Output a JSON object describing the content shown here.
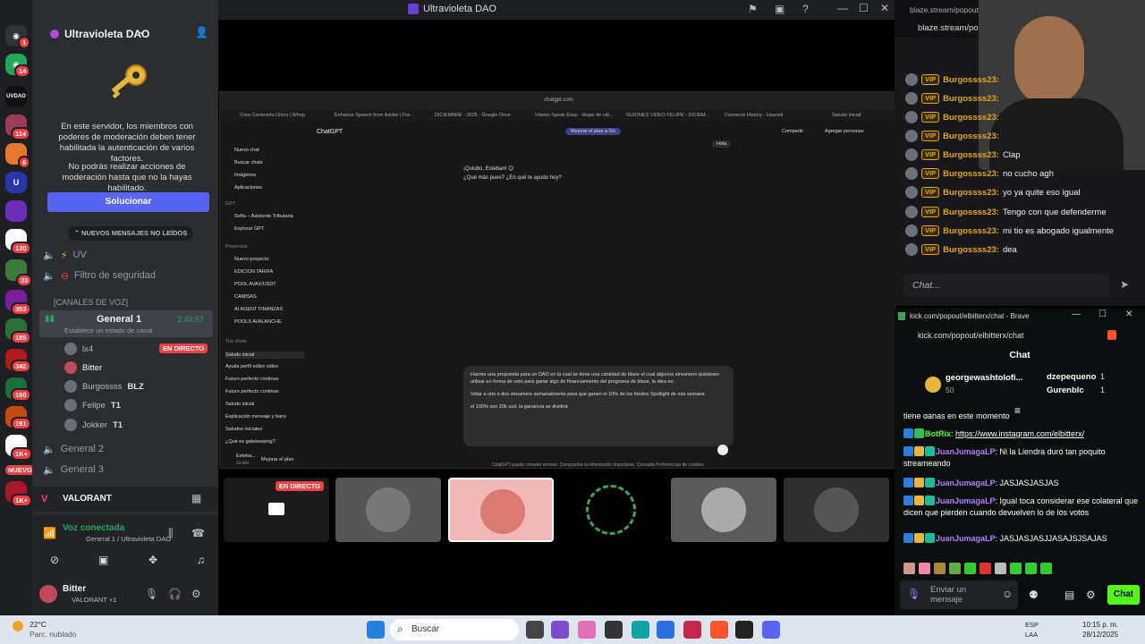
{
  "window": {
    "title": "Ultravioleta DAO"
  },
  "rail": {
    "badges": [
      "1",
      "14",
      "114",
      "6",
      "130",
      "33",
      "353",
      "185",
      "342",
      "160",
      "191",
      "1K+",
      "NUEVO",
      "1K+"
    ],
    "app_label": "UVDAO"
  },
  "sidebar": {
    "server_name": "Ultravioleta DAO",
    "mfa_notice": "En este servidor, los miembros con poderes de moderación deben tener habilitada la autenticación de varios factores.",
    "mfa_notice2": "No podrás realizar acciones de moderación hasta que no la hayas habilitado.",
    "fix_button": "Solucionar",
    "new_messages": "NUEVOS MENSAJES NO LEÍDOS",
    "channels": [
      "UV",
      "Filtro de seguridad"
    ],
    "voice_header": "[CANALES DE VOZ]",
    "voice_channel": "General 1",
    "voice_timer": "2:49:57",
    "status_placeholder": "Establece un estado de canal",
    "members": [
      {
        "name": "lx4",
        "tag": ""
      },
      {
        "name": "Bitter",
        "tag": ""
      },
      {
        "name": "Burgossss",
        "tag": "BLZ"
      },
      {
        "name": "Felipe",
        "tag": "T1"
      },
      {
        "name": "Jokker",
        "tag": "T1"
      }
    ],
    "live_badge": "EN DIRECTO",
    "other_voice": [
      "General 2",
      "General 3"
    ],
    "activity": "VALORANT",
    "voice_connected": "Voz conectada",
    "voice_location": "General 1 / Ultravioleta DAO",
    "user_name": "Bitter",
    "user_status": "VALORANT +1"
  },
  "stream": {
    "browser_url": "chatgpt.com",
    "tabs": [
      "Crea Contenido Único | Whop",
      "Enhance Speech from Adobe | Fre...",
      "DICIEMBRE - 2025 - Google Drive",
      "Videos Speak Easy - Hojas de cál...",
      "GUIONES VIDEO FELIPE - DICIEM...",
      "Connects History - Upwork",
      "Saludo inicial"
    ],
    "app_name": "ChatGPT",
    "upgrade": "Mejorar el plan a Go",
    "share": "Compartir",
    "add_people": "Agregar personas",
    "sidebar_items": [
      "Nuevo chat",
      "Buscar chats",
      "Imágenes",
      "Aplicaciones"
    ],
    "gpt_header": "GPT",
    "gpt_items": [
      "Sofía – Asistente Tributaria",
      "Explorar GPT"
    ],
    "projects_header": "Proyectos",
    "projects": [
      "Nuevo proyecto",
      "EDICION TARIFA",
      "POOL AVAX/USDT",
      "CAMISAS",
      "AI AGENT FINANZAS",
      "POOLS AVALANCHE"
    ],
    "chats_header": "Tus chats",
    "chats": [
      "Saludo inicial",
      "Ayuda perfil editor video",
      "Futuro perfecto continuo",
      "Futuro perfecto continuo",
      "Saludo inicial",
      "Explicación mensaje y bans",
      "Saludos iniciales",
      "¿Qué es gatekeeping?"
    ],
    "account_name": "Esteba...",
    "account_plan": "Gratis",
    "account_upgrade": "Mejorar el plan",
    "hola": "Hola",
    "greeting1": "¡Quiubo, Esteban! 😊",
    "greeting2": "¿Qué más pues? ¿En qué te ayudo hoy?",
    "prompt_p1": "Hazme una propuesta para un DAO en la cual se tiene una cantidad de blaze el cual algunos streamers quisiesen utilizar en forma de voto para ganar algo de financiamiento del programa de blaze, la idea es:",
    "prompt_p2": "Votar a uno o dos streamers semanalmente para que ganen el 10% de los fondos Spotlight de esa semana.",
    "prompt_p3": "el 100% son 20k usd, la ganancia se dividirá",
    "disclaimer": "ChatGPT puede cometer errores. Comprueba la información importante. Consulta Preferencias de cookies.",
    "tile_live": "EN DIRECTO"
  },
  "chat1": {
    "url_title": "blaze.stream/popout/...",
    "url": "blaze.stream/pop",
    "vip": "VIP",
    "user": "Burgossss23",
    "messages": [
      "Clap",
      "no cucho agh",
      "yo ya quite eso igual",
      "Tengo con que defenderme",
      "mi tio es abogado igualmente",
      "dea"
    ],
    "input_placeholder": "Chat..."
  },
  "chat2": {
    "window_title": "kick.com/popout/elbitterx/chat - Brave",
    "url": "kick.com/popout/elbitterx/chat",
    "header": "Chat",
    "top_gifter": "georgewashtolofi...",
    "top_gifter_count": "50",
    "gifter2": "dzepequeno",
    "gifter2_count": "1",
    "gifter3": "Gurenblc",
    "gifter3_count": "1",
    "cut_text": "tiene ganas en este momento",
    "messages": [
      {
        "user": "BotRix",
        "text": "https://www.instagram.com/elbitterx/"
      },
      {
        "user": "JuanJumagaLP",
        "text": "Ni la Liendra duró tan poquito streameando"
      },
      {
        "user": "JuanJumagaLP",
        "text": "JASJASJASJAS"
      },
      {
        "user": "JuanJumagaLP",
        "text": "Igual toca considerar ese colateral que dicen que pierden cuando devuelven lo de los votos"
      },
      {
        "user": "JuanJumagaLP",
        "text": "JASJASJASJJASAJSJSAJAS"
      }
    ],
    "input_placeholder": "Enviar un mensaje",
    "send": "Chat"
  },
  "taskbar": {
    "temp": "22°C",
    "weather": "Parc. nublado",
    "search": "Buscar",
    "lang1": "ESP",
    "lang2": "LAA",
    "time": "10:15 p. m.",
    "date": "28/12/2025"
  },
  "colors": {
    "discord_bg": "#2b2d31",
    "accent": "#5865f2",
    "kick_green": "#53fc18",
    "vip_gold": "#e0a800",
    "live_red": "#ed4245"
  }
}
